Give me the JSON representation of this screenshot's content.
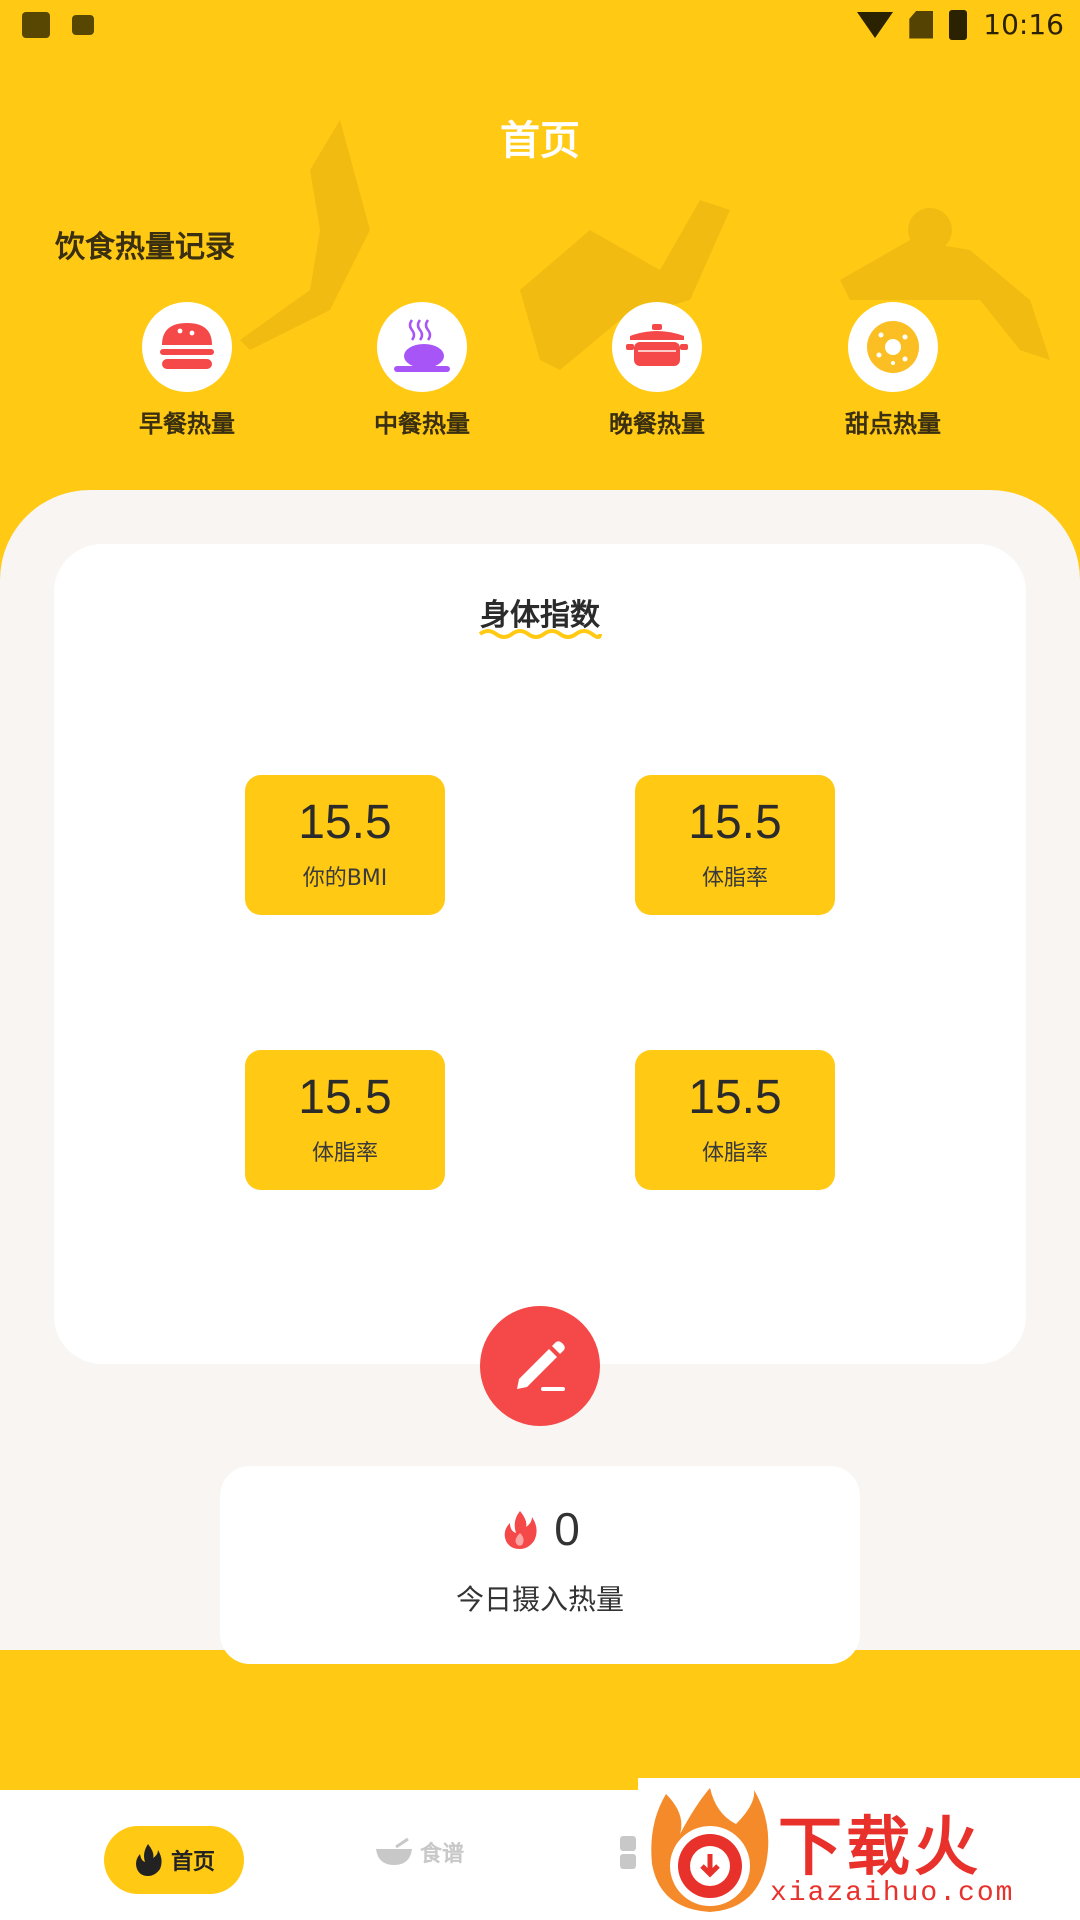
{
  "status_bar": {
    "time": "10:16"
  },
  "header": {
    "title": "首页",
    "section_title": "饮食热量记录"
  },
  "meals": [
    {
      "label": "早餐热量",
      "icon": "burger-icon"
    },
    {
      "label": "中餐热量",
      "icon": "roast-chicken-icon"
    },
    {
      "label": "晚餐热量",
      "icon": "pot-icon"
    },
    {
      "label": "甜点热量",
      "icon": "donut-icon"
    }
  ],
  "body_index": {
    "title": "身体指数",
    "metrics": [
      {
        "value": "15.5",
        "label": "你的BMI"
      },
      {
        "value": "15.5",
        "label": "体脂率"
      },
      {
        "value": "15.5",
        "label": "体脂率"
      },
      {
        "value": "15.5",
        "label": "体脂率"
      }
    ]
  },
  "intake": {
    "value": "0",
    "label": "今日摄入热量"
  },
  "nav": {
    "home": "首页",
    "recipes": "食谱"
  },
  "watermark": {
    "brand": "下载火",
    "url": "xiazaihuo.com"
  },
  "colors": {
    "accent": "#FFC914",
    "red": "#F54848",
    "purple": "#A855F7"
  }
}
